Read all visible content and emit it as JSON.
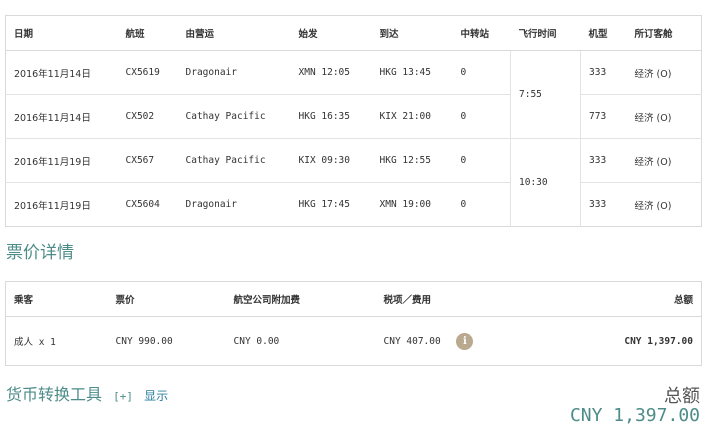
{
  "flights_table": {
    "headers": {
      "date": "日期",
      "flight": "航班",
      "operated_by": "由营运",
      "departure": "始发",
      "arrival": "到达",
      "stops": "中转站",
      "duration": "飞行时间",
      "aircraft": "机型",
      "cabin": "所订客舱"
    },
    "rows": [
      {
        "date": "2016年11月14日",
        "flight": "CX5619",
        "operator": "Dragonair",
        "departure": "XMN 12:05",
        "arrival": "HKG 13:45",
        "stops": "0",
        "aircraft": "333",
        "cabin": "经济 (O)"
      },
      {
        "date": "2016年11月14日",
        "flight": "CX502",
        "operator": "Cathay Pacific",
        "departure": "HKG 16:35",
        "arrival": "KIX 21:00",
        "stops": "0",
        "aircraft": "773",
        "cabin": "经济 (O)"
      },
      {
        "date": "2016年11月19日",
        "flight": "CX567",
        "operator": "Cathay Pacific",
        "departure": "KIX 09:30",
        "arrival": "HKG 12:55",
        "stops": "0",
        "aircraft": "333",
        "cabin": "经济 (O)"
      },
      {
        "date": "2016年11月19日",
        "flight": "CX5604",
        "operator": "Dragonair",
        "departure": "HKG 17:45",
        "arrival": "XMN 19:00",
        "stops": "0",
        "aircraft": "333",
        "cabin": "经济 (O)"
      }
    ],
    "durations": [
      "7:55",
      "10:30"
    ]
  },
  "fare_details": {
    "title": "票价详情",
    "headers": {
      "passenger": "乘客",
      "fare": "票价",
      "surcharge": "航空公司附加费",
      "taxes": "税项／费用",
      "total": "总额"
    },
    "row": {
      "passenger": "成人 x 1",
      "fare": "CNY 990.00",
      "surcharge": "CNY 0.00",
      "taxes": "CNY 407.00",
      "info_icon_glyph": "i",
      "total": "CNY 1,397.00"
    }
  },
  "currency_converter": {
    "label": "货币转换工具",
    "toggle": "[+]",
    "show": "显示"
  },
  "grand_total": {
    "label": "总额",
    "value": "CNY 1,397.00"
  },
  "colors": {
    "accent_teal": "#4d8c89",
    "link_blue": "#2b7f9c",
    "info_icon_bg": "#b9a98e"
  }
}
